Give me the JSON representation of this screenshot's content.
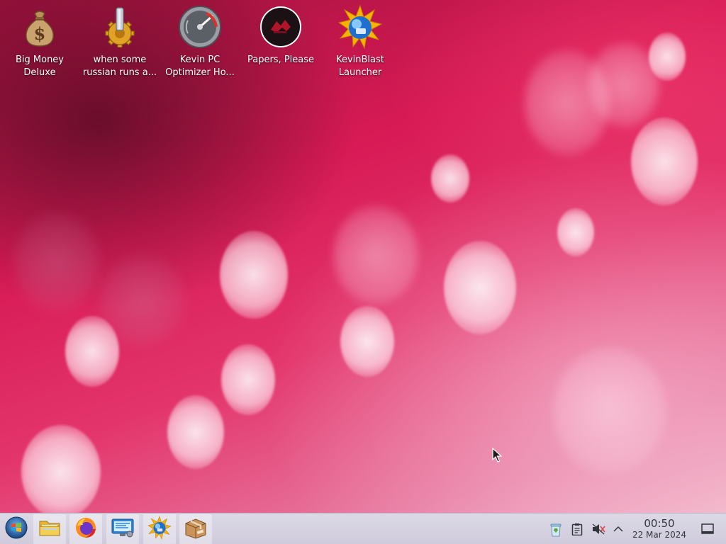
{
  "desktop": {
    "icons": [
      {
        "label": "Big Money\nDeluxe",
        "icon": "money-bag-icon"
      },
      {
        "label": "when some\nrussian runs a...",
        "icon": "gear-icon"
      },
      {
        "label": "Kevin PC\nOptimizer Ho...",
        "icon": "gauge-icon"
      },
      {
        "label": "Papers, Please",
        "icon": "papers-please-icon"
      },
      {
        "label": "KevinBlast\nLauncher",
        "icon": "kevinblast-icon"
      }
    ]
  },
  "taskbar": {
    "launchers": [
      {
        "name": "start-menu",
        "icon": "windows-orb-icon"
      },
      {
        "name": "file-manager",
        "icon": "folder-icon"
      },
      {
        "name": "firefox",
        "icon": "firefox-icon"
      },
      {
        "name": "system-monitor",
        "icon": "monitor-icon"
      },
      {
        "name": "kevinblast",
        "icon": "kevinblast-icon"
      },
      {
        "name": "package-manager",
        "icon": "package-box-icon"
      }
    ],
    "tray": {
      "icons": [
        "recycle-bin-icon",
        "clipboard-icon",
        "volume-muted-icon",
        "chevron-up-icon"
      ],
      "time": "00:50",
      "date": "22 Mar 2024",
      "show_desktop_icon": "show-desktop-icon"
    }
  },
  "colors": {
    "wallpaper_deep": "#a0123e",
    "wallpaper_mid": "#d81a55",
    "wallpaper_light": "#f0b5c8",
    "taskbar_bg": "#dcd9e6"
  }
}
